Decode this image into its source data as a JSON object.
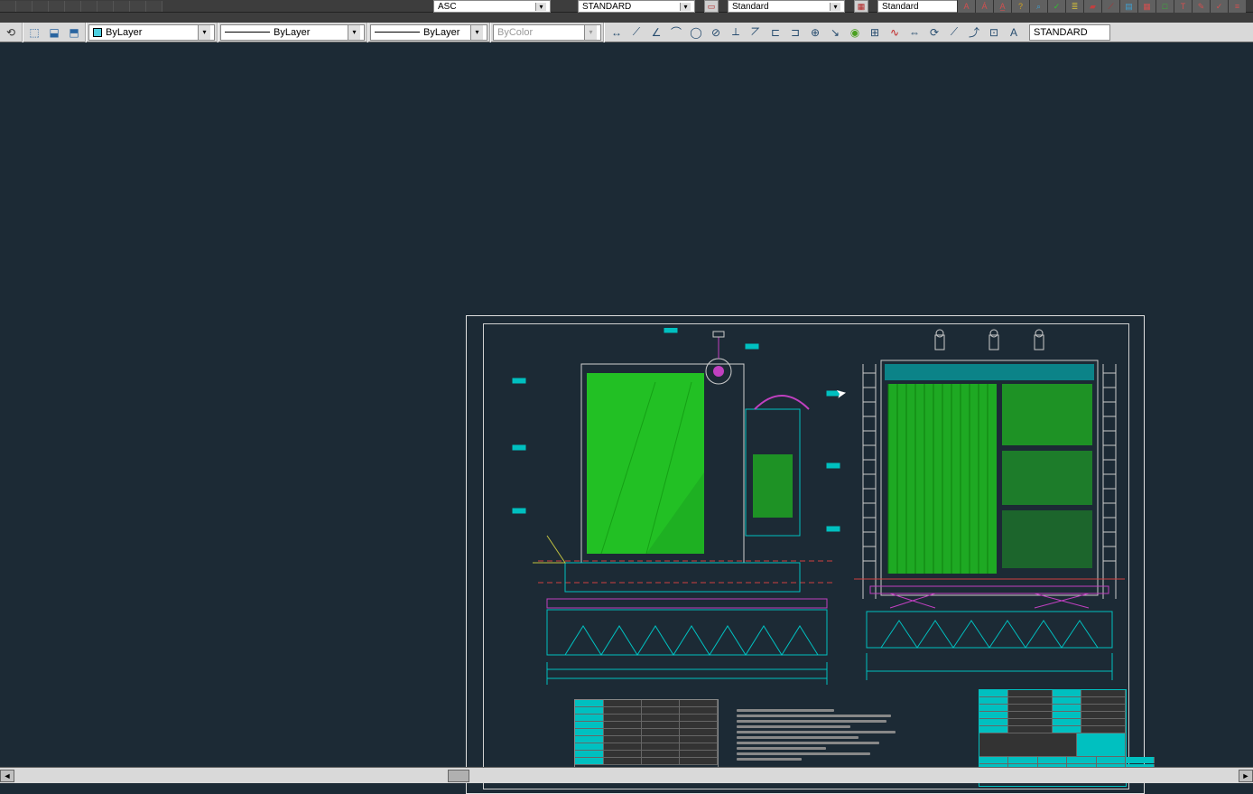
{
  "toolbar": {
    "row1_hint": "file/edit quick-access icons (cropped)"
  },
  "styles": {
    "text_style": "ASC",
    "dim_style": "STANDARD",
    "table_style": "Standard",
    "mleader_style": "Standard"
  },
  "prop": {
    "layer_color_label": "ByLayer",
    "linetype_label": "ByLayer",
    "lineweight_label": "ByLayer",
    "plotstyle_placeholder": "ByColor",
    "dim_style_box": "STANDARD"
  },
  "dim_icons": [
    "linear",
    "aligned",
    "angular",
    "arc",
    "radius",
    "diameter",
    "ordinate",
    "jogged",
    "baseline",
    "continue",
    "center",
    "leader",
    "tolerance",
    "inspect",
    "break",
    "reassoc",
    "update",
    "oblique",
    "textrot"
  ],
  "a_icons": [
    "A",
    "Á",
    "A̲",
    "A?",
    "â",
    "find",
    "stack",
    "clr",
    "T",
    "L",
    "tbl",
    "fld",
    "mtxt",
    "edit",
    "sp",
    "just"
  ],
  "drawing": {
    "views": [
      "left-section",
      "right-elevation"
    ],
    "tables": [
      "spec-table",
      "title-block",
      "parts-list"
    ]
  },
  "scrollbar": {
    "arrows": [
      "◄",
      "►"
    ]
  }
}
